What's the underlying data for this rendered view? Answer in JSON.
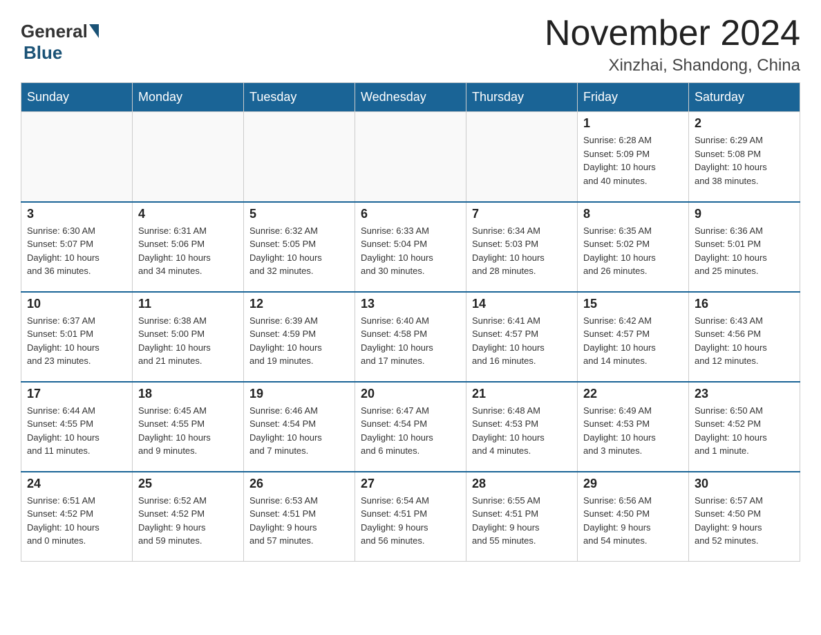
{
  "header": {
    "logo_general": "General",
    "logo_blue": "Blue",
    "month_year": "November 2024",
    "location": "Xinzhai, Shandong, China"
  },
  "days_of_week": [
    "Sunday",
    "Monday",
    "Tuesday",
    "Wednesday",
    "Thursday",
    "Friday",
    "Saturday"
  ],
  "weeks": [
    [
      {
        "day": "",
        "info": ""
      },
      {
        "day": "",
        "info": ""
      },
      {
        "day": "",
        "info": ""
      },
      {
        "day": "",
        "info": ""
      },
      {
        "day": "",
        "info": ""
      },
      {
        "day": "1",
        "info": "Sunrise: 6:28 AM\nSunset: 5:09 PM\nDaylight: 10 hours\nand 40 minutes."
      },
      {
        "day": "2",
        "info": "Sunrise: 6:29 AM\nSunset: 5:08 PM\nDaylight: 10 hours\nand 38 minutes."
      }
    ],
    [
      {
        "day": "3",
        "info": "Sunrise: 6:30 AM\nSunset: 5:07 PM\nDaylight: 10 hours\nand 36 minutes."
      },
      {
        "day": "4",
        "info": "Sunrise: 6:31 AM\nSunset: 5:06 PM\nDaylight: 10 hours\nand 34 minutes."
      },
      {
        "day": "5",
        "info": "Sunrise: 6:32 AM\nSunset: 5:05 PM\nDaylight: 10 hours\nand 32 minutes."
      },
      {
        "day": "6",
        "info": "Sunrise: 6:33 AM\nSunset: 5:04 PM\nDaylight: 10 hours\nand 30 minutes."
      },
      {
        "day": "7",
        "info": "Sunrise: 6:34 AM\nSunset: 5:03 PM\nDaylight: 10 hours\nand 28 minutes."
      },
      {
        "day": "8",
        "info": "Sunrise: 6:35 AM\nSunset: 5:02 PM\nDaylight: 10 hours\nand 26 minutes."
      },
      {
        "day": "9",
        "info": "Sunrise: 6:36 AM\nSunset: 5:01 PM\nDaylight: 10 hours\nand 25 minutes."
      }
    ],
    [
      {
        "day": "10",
        "info": "Sunrise: 6:37 AM\nSunset: 5:01 PM\nDaylight: 10 hours\nand 23 minutes."
      },
      {
        "day": "11",
        "info": "Sunrise: 6:38 AM\nSunset: 5:00 PM\nDaylight: 10 hours\nand 21 minutes."
      },
      {
        "day": "12",
        "info": "Sunrise: 6:39 AM\nSunset: 4:59 PM\nDaylight: 10 hours\nand 19 minutes."
      },
      {
        "day": "13",
        "info": "Sunrise: 6:40 AM\nSunset: 4:58 PM\nDaylight: 10 hours\nand 17 minutes."
      },
      {
        "day": "14",
        "info": "Sunrise: 6:41 AM\nSunset: 4:57 PM\nDaylight: 10 hours\nand 16 minutes."
      },
      {
        "day": "15",
        "info": "Sunrise: 6:42 AM\nSunset: 4:57 PM\nDaylight: 10 hours\nand 14 minutes."
      },
      {
        "day": "16",
        "info": "Sunrise: 6:43 AM\nSunset: 4:56 PM\nDaylight: 10 hours\nand 12 minutes."
      }
    ],
    [
      {
        "day": "17",
        "info": "Sunrise: 6:44 AM\nSunset: 4:55 PM\nDaylight: 10 hours\nand 11 minutes."
      },
      {
        "day": "18",
        "info": "Sunrise: 6:45 AM\nSunset: 4:55 PM\nDaylight: 10 hours\nand 9 minutes."
      },
      {
        "day": "19",
        "info": "Sunrise: 6:46 AM\nSunset: 4:54 PM\nDaylight: 10 hours\nand 7 minutes."
      },
      {
        "day": "20",
        "info": "Sunrise: 6:47 AM\nSunset: 4:54 PM\nDaylight: 10 hours\nand 6 minutes."
      },
      {
        "day": "21",
        "info": "Sunrise: 6:48 AM\nSunset: 4:53 PM\nDaylight: 10 hours\nand 4 minutes."
      },
      {
        "day": "22",
        "info": "Sunrise: 6:49 AM\nSunset: 4:53 PM\nDaylight: 10 hours\nand 3 minutes."
      },
      {
        "day": "23",
        "info": "Sunrise: 6:50 AM\nSunset: 4:52 PM\nDaylight: 10 hours\nand 1 minute."
      }
    ],
    [
      {
        "day": "24",
        "info": "Sunrise: 6:51 AM\nSunset: 4:52 PM\nDaylight: 10 hours\nand 0 minutes."
      },
      {
        "day": "25",
        "info": "Sunrise: 6:52 AM\nSunset: 4:52 PM\nDaylight: 9 hours\nand 59 minutes."
      },
      {
        "day": "26",
        "info": "Sunrise: 6:53 AM\nSunset: 4:51 PM\nDaylight: 9 hours\nand 57 minutes."
      },
      {
        "day": "27",
        "info": "Sunrise: 6:54 AM\nSunset: 4:51 PM\nDaylight: 9 hours\nand 56 minutes."
      },
      {
        "day": "28",
        "info": "Sunrise: 6:55 AM\nSunset: 4:51 PM\nDaylight: 9 hours\nand 55 minutes."
      },
      {
        "day": "29",
        "info": "Sunrise: 6:56 AM\nSunset: 4:50 PM\nDaylight: 9 hours\nand 54 minutes."
      },
      {
        "day": "30",
        "info": "Sunrise: 6:57 AM\nSunset: 4:50 PM\nDaylight: 9 hours\nand 52 minutes."
      }
    ]
  ]
}
